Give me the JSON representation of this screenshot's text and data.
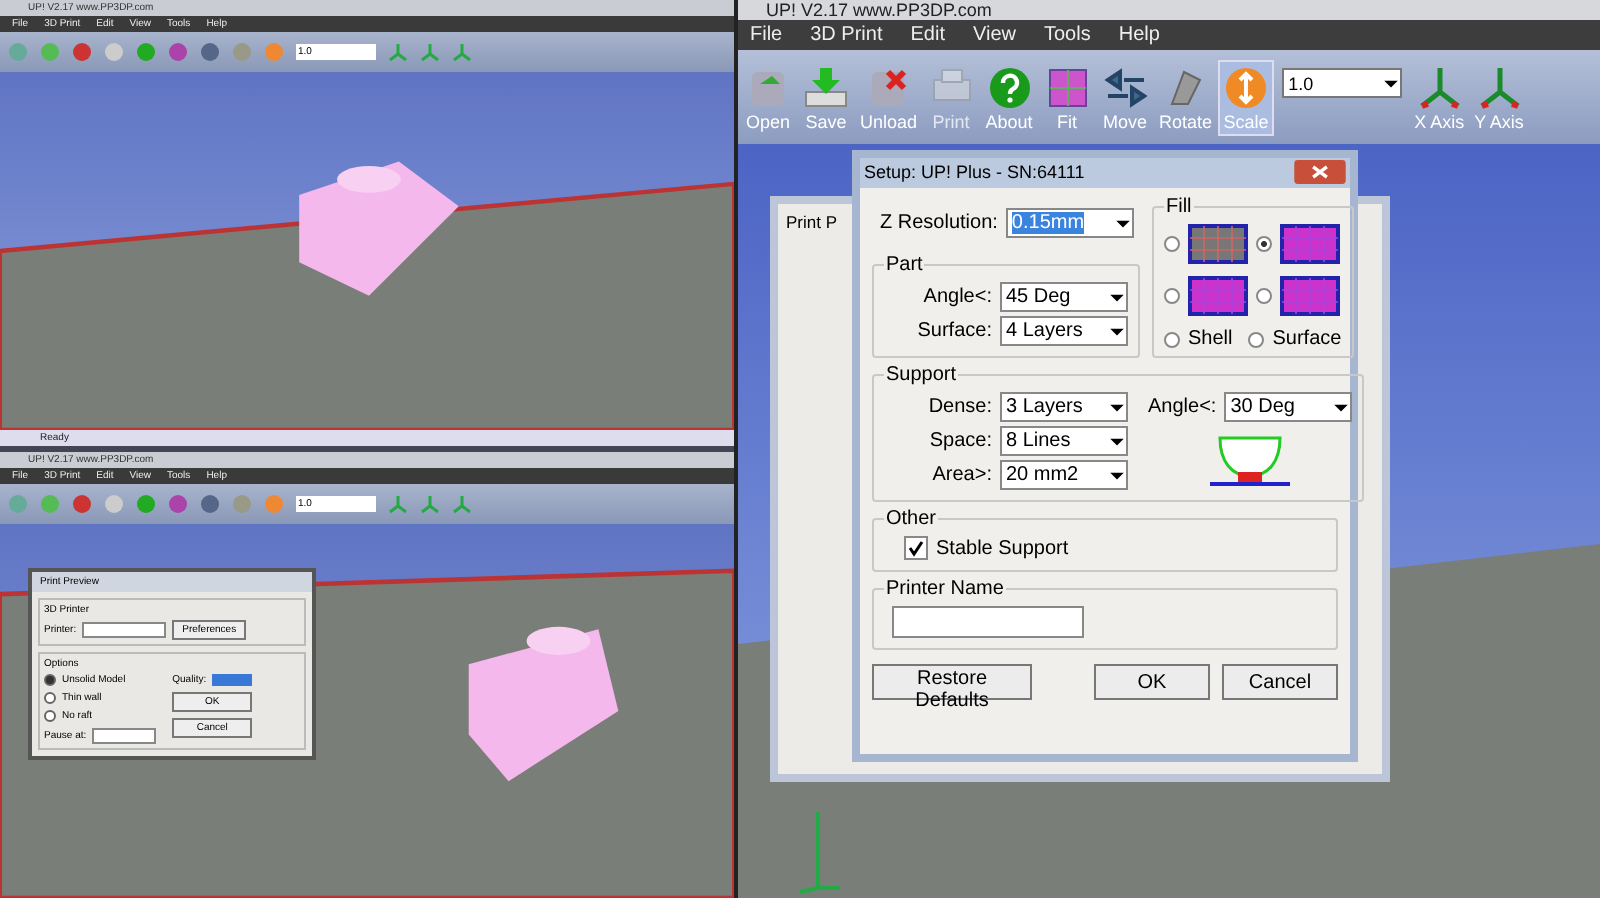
{
  "left_top_window": {
    "title": "UP! V2.17 www.PP3DP.com",
    "menu": [
      "File",
      "3D Print",
      "Edit",
      "View",
      "Tools",
      "Help"
    ],
    "combo_value": "1.0",
    "status": "Ready"
  },
  "left_bottom_window": {
    "title": "UP! V2.17 www.PP3DP.com",
    "menu": [
      "File",
      "3D Print",
      "Edit",
      "View",
      "Tools",
      "Help"
    ],
    "combo_value": "1.0",
    "dialog": {
      "title": "Print Preview",
      "printer_group": "3D Printer",
      "printer_label": "Printer:",
      "preferences_button": "Preferences",
      "options_group": "Options",
      "options": [
        {
          "label": "Unsolid Model",
          "checked": true
        },
        {
          "label": "Thin wall",
          "checked": false
        },
        {
          "label": "No raft",
          "checked": false
        }
      ],
      "quality_label": "Quality:",
      "pause_label": "Pause at:",
      "buttons": [
        "OK",
        "Cancel"
      ]
    }
  },
  "main_window": {
    "title": "UP! V2.17 www.PP3DP.com",
    "menu": [
      "File",
      "3D Print",
      "Edit",
      "View",
      "Tools",
      "Help"
    ],
    "toolbar": [
      {
        "label": "Open",
        "disabled": false,
        "selected": false
      },
      {
        "label": "Save",
        "disabled": false,
        "selected": false
      },
      {
        "label": "Unload",
        "disabled": false,
        "selected": false
      },
      {
        "label": "Print",
        "disabled": true,
        "selected": false
      },
      {
        "label": "About",
        "disabled": false,
        "selected": false
      },
      {
        "label": "Fit",
        "disabled": false,
        "selected": false
      },
      {
        "label": "Move",
        "disabled": false,
        "selected": false
      },
      {
        "label": "Rotate",
        "disabled": false,
        "selected": false
      },
      {
        "label": "Scale",
        "disabled": false,
        "selected": true
      }
    ],
    "combo_value": "1.0",
    "axis_buttons": [
      "X Axis",
      "Y Axis"
    ],
    "background_dialog": {
      "title": "Print P"
    },
    "setup_dialog": {
      "title": "Setup: UP! Plus - SN:64111",
      "z_resolution": {
        "label": "Z Resolution:",
        "value": "0.15mm"
      },
      "part": {
        "title": "Part",
        "fields": [
          {
            "label": "Angle<:",
            "value": "45 Deg"
          },
          {
            "label": "Surface:",
            "value": "4 Layers"
          }
        ]
      },
      "fill": {
        "title": "Fill",
        "patterns": [
          {
            "selected": false
          },
          {
            "selected": true
          },
          {
            "selected": false
          },
          {
            "selected": false
          }
        ],
        "modes": [
          {
            "label": "Shell",
            "selected": false
          },
          {
            "label": "Surface",
            "selected": false
          }
        ]
      },
      "support": {
        "title": "Support",
        "fields": [
          {
            "label": "Dense:",
            "value": "3 Layers"
          },
          {
            "label": "Space:",
            "value": "8 Lines"
          },
          {
            "label": "Area>:",
            "value": "20 mm2"
          }
        ],
        "angle": {
          "label": "Angle<:",
          "value": "30 Deg"
        }
      },
      "other": {
        "title": "Other",
        "stable_support": {
          "label": "Stable Support",
          "checked": true
        }
      },
      "printer_name": {
        "title": "Printer Name"
      },
      "buttons": [
        "Restore Defaults",
        "OK",
        "Cancel"
      ]
    }
  }
}
